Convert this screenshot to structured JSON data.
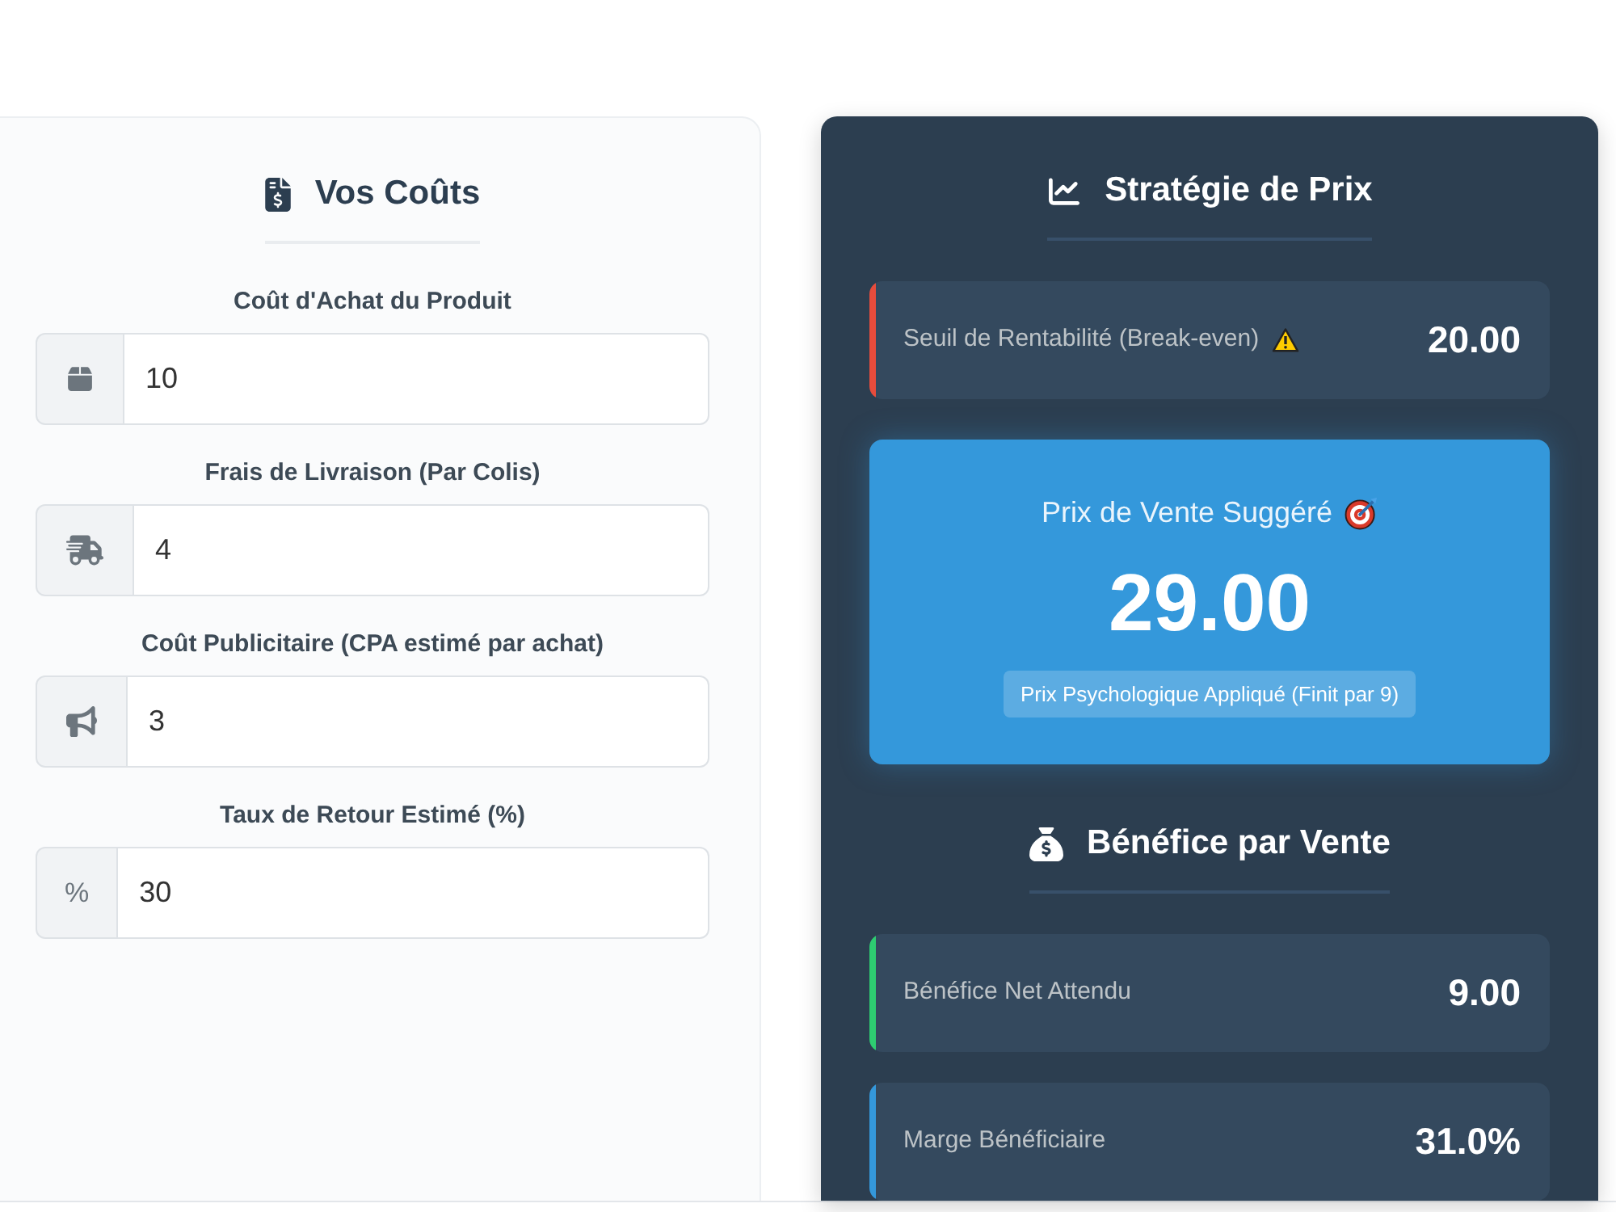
{
  "costs": {
    "title": "Vos Coûts",
    "fields": [
      {
        "label": "Coût d'Achat du Produit",
        "kind": "icon",
        "value": "10"
      },
      {
        "label": "Frais de Livraison (Par Colis)",
        "kind": "icon",
        "value": "4"
      },
      {
        "label": "Coût Publicitaire (CPA estimé par achat)",
        "kind": "icon",
        "value": "3"
      },
      {
        "label": "Taux de Retour Estimé (%)",
        "kind": "text",
        "addon": "%",
        "value": "30"
      }
    ]
  },
  "strategy": {
    "title": "Stratégie de Prix",
    "break_even": {
      "label": "Seuil de Rentabilité (Break-even)",
      "value": "20.00",
      "color": "#e74c3c"
    },
    "suggested": {
      "label": "Prix de Vente Suggéré",
      "price": "29.00",
      "badge": "Prix Psychologique Appliqué (Finit par 9)"
    }
  },
  "profit": {
    "title": "Bénéfice par Vente",
    "results": [
      {
        "label": "Bénéfice Net Attendu",
        "value": "9.00",
        "color": "#2ecc71"
      },
      {
        "label": "Marge Bénéficiaire",
        "value": "31.0%",
        "color": "#3498db"
      }
    ]
  }
}
